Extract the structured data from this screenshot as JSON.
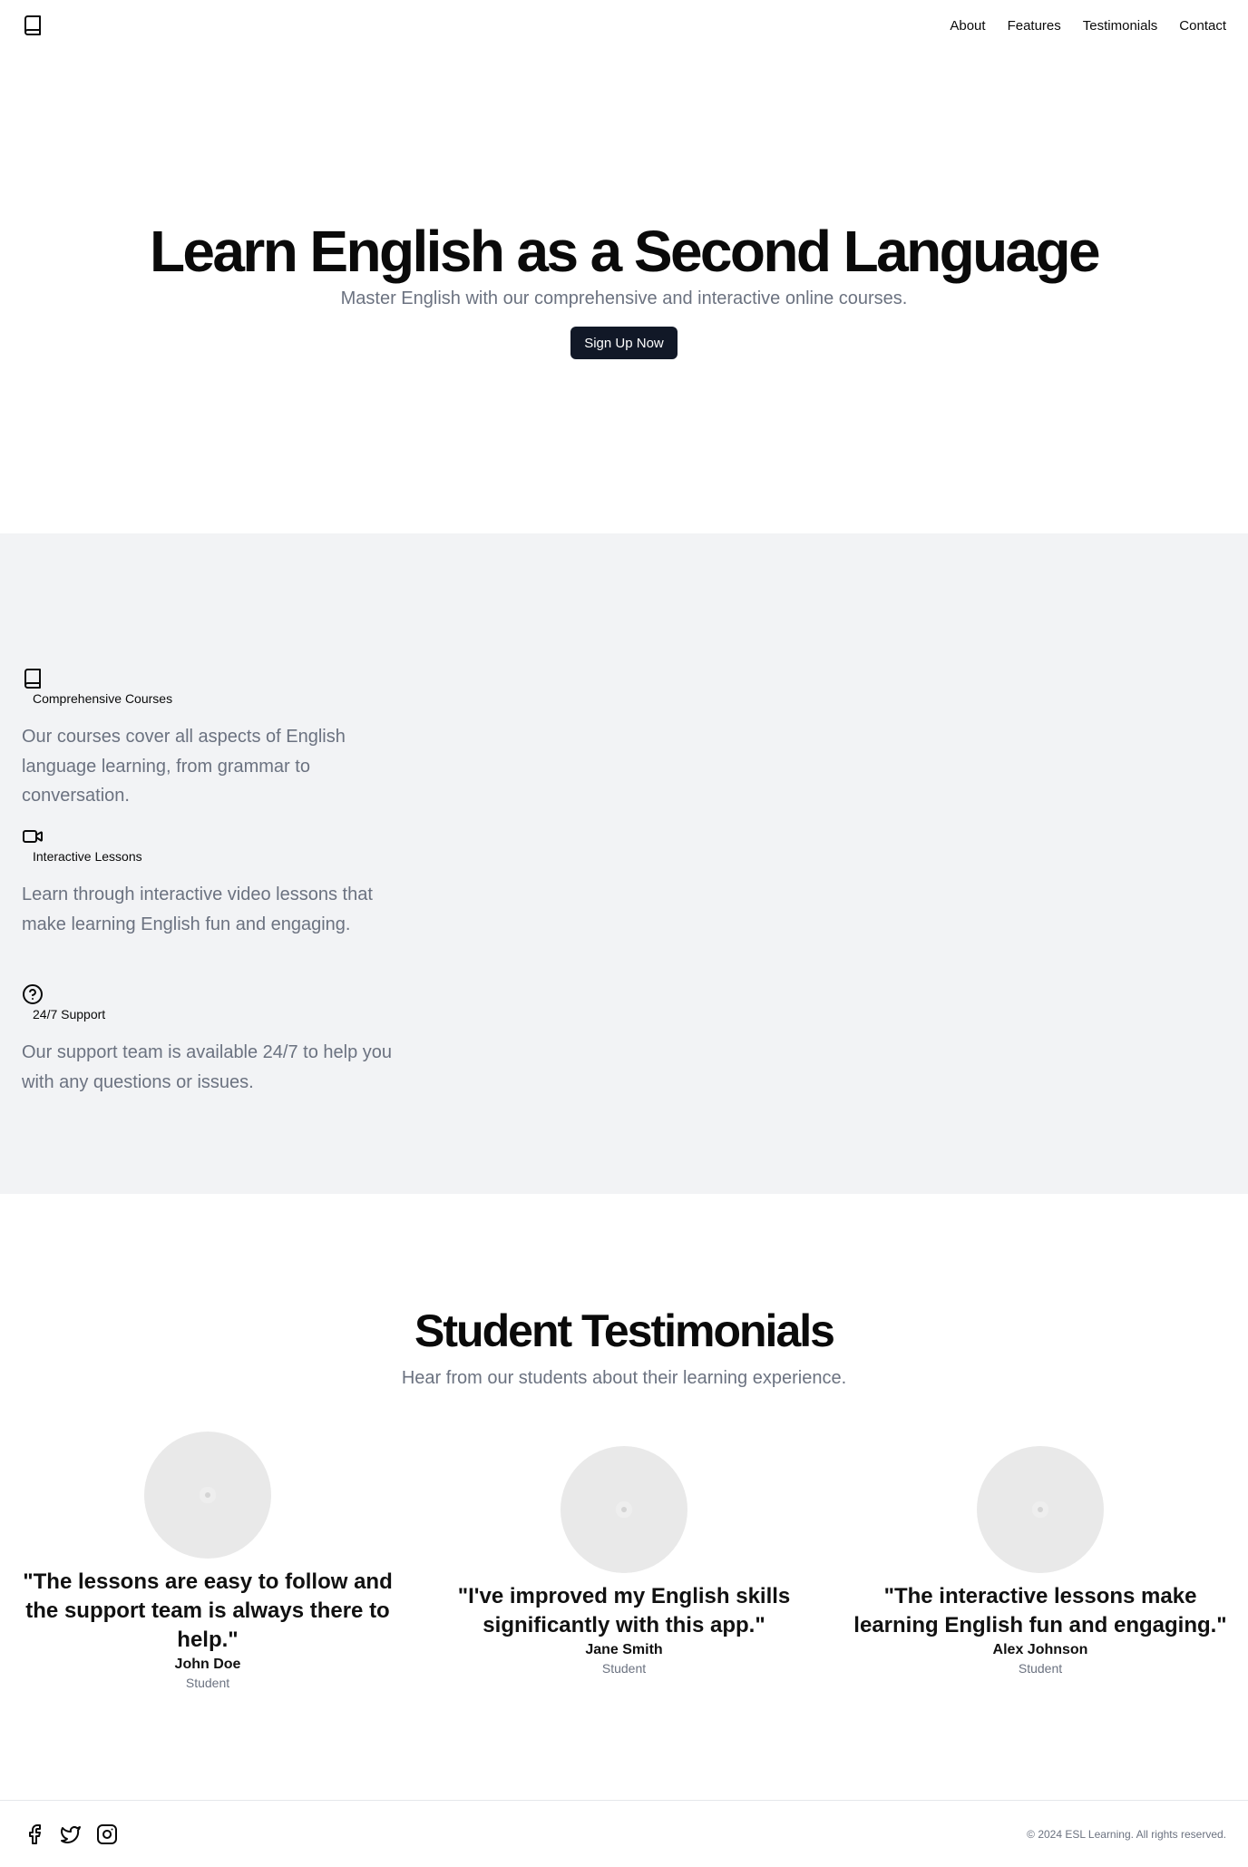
{
  "nav": {
    "logo_icon": "book-icon",
    "links": [
      "About",
      "Features",
      "Testimonials",
      "Contact"
    ]
  },
  "hero": {
    "title": "Learn English as a Second Language",
    "subtitle": "Master English with our comprehensive and interactive online courses.",
    "cta_label": "Sign Up Now"
  },
  "features": [
    {
      "icon": "book-icon",
      "title": "Comprehensive Courses",
      "description": "Our courses cover all aspects of English language learning, from grammar to conversation."
    },
    {
      "icon": "video-icon",
      "title": "Interactive Lessons",
      "description": "Learn through interactive video lessons that make learning English fun and engaging."
    },
    {
      "icon": "help-circle-icon",
      "title": "24/7 Support",
      "description": "Our support team is available 24/7 to help you with any questions or issues."
    }
  ],
  "testimonials": {
    "heading": "Student Testimonials",
    "subheading": "Hear from our students about their learning experience.",
    "items": [
      {
        "quote": "\"The lessons are easy to follow and the support team is always there to help.\"",
        "name": "John Doe",
        "role": "Student"
      },
      {
        "quote": "\"I've improved my English skills significantly with this app.\"",
        "name": "Jane Smith",
        "role": "Student"
      },
      {
        "quote": "\"The interactive lessons make learning English fun and engaging.\"",
        "name": "Alex Johnson",
        "role": "Student"
      }
    ]
  },
  "footer": {
    "social_icons": [
      "facebook-icon",
      "twitter-icon",
      "instagram-icon"
    ],
    "copyright": "© 2024 ESL Learning. All rights reserved."
  },
  "colors": {
    "primary_button": "#111827",
    "muted_text": "#6b7280",
    "features_background": "#f2f3f5"
  }
}
